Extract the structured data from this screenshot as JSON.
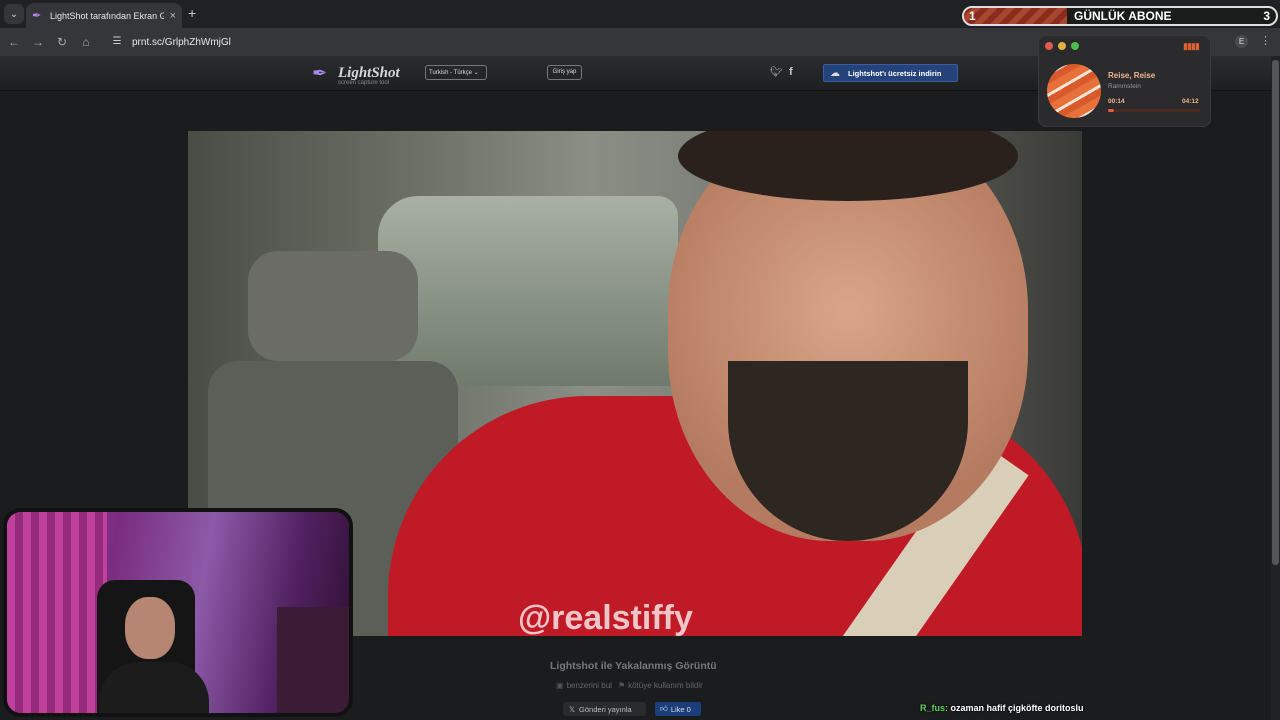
{
  "browser": {
    "tab_title": "LightShot tarafından Ekran Görüntüsü",
    "url": "prnt.sc/GrlphZhWmjGl",
    "profile_initial": "E"
  },
  "lightshot": {
    "logo_title": "LightShot",
    "logo_subtitle": "screen capture tool",
    "language": "Turkish - Türkçe",
    "login_label": "Giriş yap",
    "download_label": "Lightshot'ı ücretsiz indirin",
    "caption": "Lightshot ile Yakalanmış Görüntü",
    "find_similar": "benzerini bul",
    "report_abuse": "kötüye kullanım bildir",
    "tweet_label": "Gönderi yayınla",
    "like_label": "Like 0"
  },
  "image": {
    "watermark": "@realstiffy"
  },
  "overlay": {
    "sub_count": "1",
    "sub_label": "GÜNLÜK ABONE",
    "sub_goal": "3",
    "sub_progress": 0.33,
    "song_title": "Reise, Reise",
    "song_artist": "Rammstein",
    "time_current": "00:14",
    "time_total": "04:12",
    "song_progress": 0.06,
    "chat_user": "R_fus:",
    "chat_message": "ozaman hafif çigköfte doritoslu"
  },
  "colors": {
    "download_button": "#25437a",
    "accent_orange": "#e0613a",
    "chat_user": "#5fd35f"
  },
  "icons": [
    "chevron-down-icon",
    "lightshot-feather-icon",
    "close-icon",
    "plus-icon",
    "back-arrow-icon",
    "forward-arrow-icon",
    "reload-icon",
    "home-icon",
    "site-settings-icon",
    "twitter-icon",
    "facebook-icon",
    "cloud-download-icon",
    "x-icon",
    "thumbs-up-icon",
    "equalizer-icon"
  ]
}
